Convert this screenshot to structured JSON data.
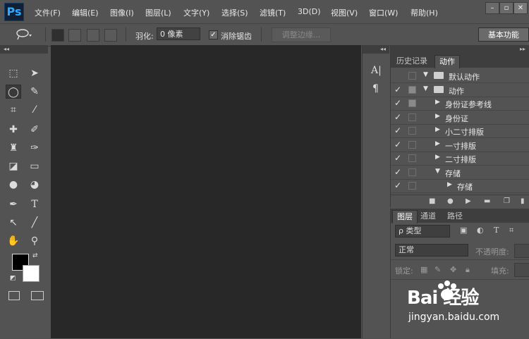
{
  "app": {
    "logo": "Ps"
  },
  "menu": [
    "文件(F)",
    "编辑(E)",
    "图像(I)",
    "图层(L)",
    "文字(Y)",
    "选择(S)",
    "滤镜(T)",
    "3D(D)",
    "视图(V)",
    "窗口(W)",
    "帮助(H)"
  ],
  "window_controls": {
    "minimize": "–",
    "restore": "▫",
    "close": "✕"
  },
  "options": {
    "feather_label": "羽化:",
    "feather_value": "0 像素",
    "antialias_label": "消除锯齿",
    "antialias_check": "✓",
    "refine_edge": "调整边缘...",
    "workspace": "基本功能"
  },
  "panels": {
    "top_tabs": [
      "历史记录",
      "动作"
    ],
    "actions": [
      {
        "check": "",
        "box": "empty",
        "tri": "▼",
        "folder": true,
        "name": "默认动作"
      },
      {
        "check": "✓",
        "box": "filled",
        "tri": "▼",
        "folder": true,
        "name": "动作"
      },
      {
        "check": "✓",
        "box": "filled",
        "tri": "▶",
        "folder": false,
        "name": "身份证参考线"
      },
      {
        "check": "✓",
        "box": "empty",
        "tri": "▶",
        "folder": false,
        "name": "身份证"
      },
      {
        "check": "✓",
        "box": "empty",
        "tri": "▶",
        "folder": false,
        "name": "小二寸排版"
      },
      {
        "check": "✓",
        "box": "empty",
        "tri": "▶",
        "folder": false,
        "name": "一寸排版"
      },
      {
        "check": "✓",
        "box": "empty",
        "tri": "▶",
        "folder": false,
        "name": "二寸排版"
      },
      {
        "check": "✓",
        "box": "empty",
        "tri": "▼",
        "folder": false,
        "name": "存储"
      },
      {
        "check": "✓",
        "box": "empty",
        "tri": "▶",
        "folder": false,
        "name": "存储"
      }
    ],
    "layer_tabs": [
      "图层",
      "通道",
      "路径"
    ],
    "layers": {
      "filter_kind": "ρ 类型",
      "blend_mode": "正常",
      "opacity_label": "不透明度:",
      "lock_label": "锁定:",
      "fill_label": "填充:"
    }
  },
  "watermark": {
    "brand": "Bai 经验",
    "url": "jingyan.baidu.com"
  }
}
